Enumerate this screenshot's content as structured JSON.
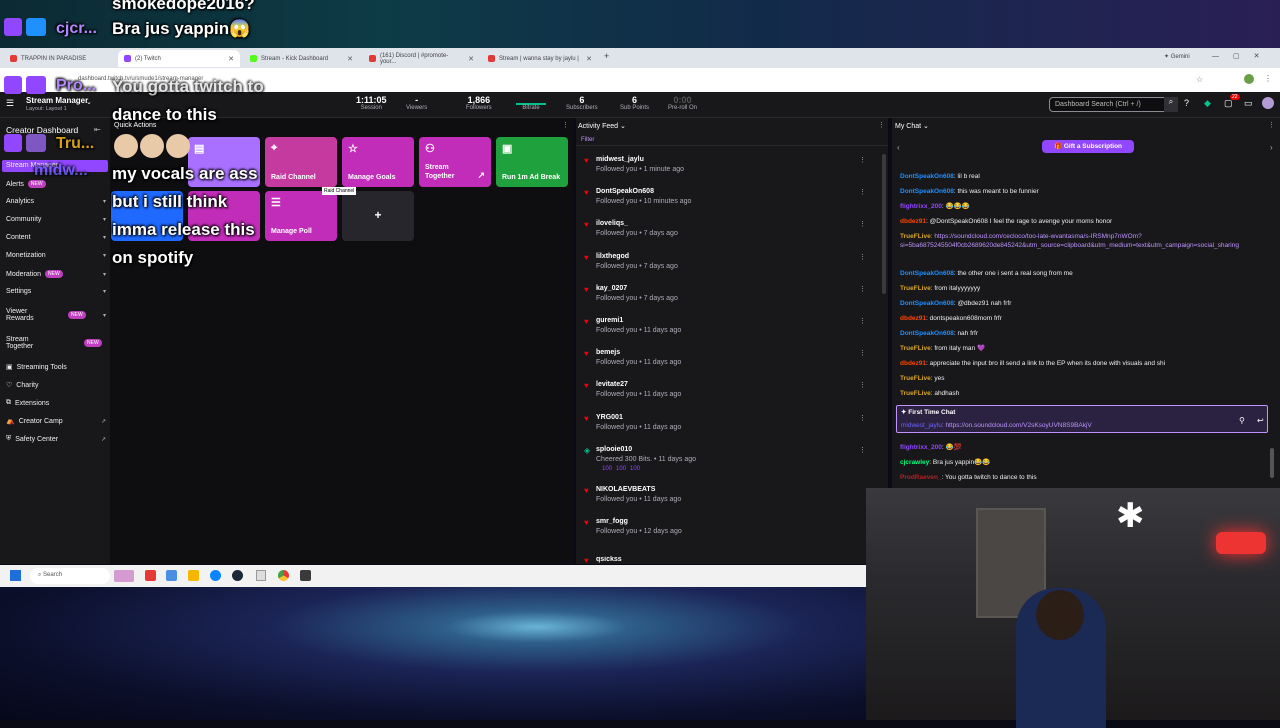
{
  "overlay": {
    "top_line": "smokedope2016?",
    "username": "cjcr...",
    "message1": "Bra jus yappin😱",
    "message2_line": "You gotta twitch to",
    "message2_line2": "dance to this",
    "user2": "Pro...",
    "user3": "Tru...",
    "user4": "midw...",
    "message3_line1": "my vocals are ass",
    "message3_line2": "but i still think",
    "message3_line3": "imma release this",
    "message3_line4": "on spotify"
  },
  "browser": {
    "tabs": [
      {
        "label": "TRAPPIN IN PARADISE",
        "color": "#e53935"
      },
      {
        "label": "(2) Twitch",
        "color": "#9146ff"
      },
      {
        "label": "Stream - Kick Dashboard",
        "color": "#53fc18"
      },
      {
        "label": "(161) Discord | #promote-your...",
        "color": "#e53935"
      },
      {
        "label": "Stream | wanna stay by jaylu |",
        "color": "#e53935"
      }
    ],
    "new_tab": "+",
    "gemini": "Gemini",
    "url": "dashboard.twitch.tv/u/smude1/stream-manager"
  },
  "header": {
    "title": "Stream Manager",
    "subtitle": "Layout: Layout 1",
    "stats": [
      {
        "value": "1:11:05",
        "label": "Session"
      },
      {
        "value": "-",
        "label": "Viewers"
      },
      {
        "value": "1,866",
        "label": "Followers"
      },
      {
        "value": "",
        "label": "Bitrate"
      },
      {
        "value": "6",
        "label": "Subscribers"
      },
      {
        "value": "6",
        "label": "Sub Points"
      },
      {
        "value": "0:00",
        "label": "Pre-roll On"
      }
    ],
    "search_placeholder": "Dashboard Search (Ctrl + /)",
    "notif_count": "22"
  },
  "sidebar": {
    "title": "Creator Dashboard",
    "items": [
      {
        "label": "Stream Manager"
      },
      {
        "label": "Alerts",
        "badge": "NEW"
      },
      {
        "label": "Analytics"
      },
      {
        "label": "Community"
      },
      {
        "label": "Content"
      },
      {
        "label": "Monetization"
      },
      {
        "label": "Moderation",
        "badge": "NEW"
      },
      {
        "label": "Settings"
      },
      {
        "label": "Viewer Rewards",
        "badge": "NEW"
      },
      {
        "label": "Stream Together",
        "badge": "NEW"
      },
      {
        "label": "Streaming Tools"
      },
      {
        "label": "Charity"
      },
      {
        "label": "Extensions"
      },
      {
        "label": "Creator Camp"
      },
      {
        "label": "Safety Center"
      }
    ]
  },
  "quick_actions": {
    "title": "Quick Actions",
    "tiles": [
      {
        "label": "",
        "color": "#a970ff"
      },
      {
        "label": "Raid Channel",
        "color": "#c53a9e"
      },
      {
        "label": "Manage Goals",
        "color": "#c12cb8"
      },
      {
        "label": "Stream Together",
        "color": "#c12cb8"
      },
      {
        "label": "Run 1m Ad Break",
        "color": "#1fa23d"
      },
      {
        "label": "Sub Only",
        "color": "#1f69ff"
      },
      {
        "label": "",
        "color": "#c12cb8"
      },
      {
        "label": "Manage Poll",
        "color": "#c12cb8"
      }
    ],
    "add": "+",
    "tooltip": "Raid Channel"
  },
  "activity": {
    "title": "Activity Feed",
    "filter": "Filter",
    "items": [
      {
        "name": "midwest_jaylu",
        "text": "Followed you • 1 minute ago"
      },
      {
        "name": "DontSpeakOn608",
        "text": "Followed you • 10 minutes ago"
      },
      {
        "name": "iloveliqs_",
        "text": "Followed you • 7 days ago"
      },
      {
        "name": "lilxthegod",
        "text": "Followed you • 7 days ago"
      },
      {
        "name": "kay_0207",
        "text": "Followed you • 7 days ago"
      },
      {
        "name": "guremi1",
        "text": "Followed you • 11 days ago"
      },
      {
        "name": "bemejs",
        "text": "Followed you • 11 days ago"
      },
      {
        "name": "levitate27",
        "text": "Followed you • 11 days ago"
      },
      {
        "name": "YRG001",
        "text": "Followed you • 11 days ago"
      },
      {
        "name": "splooie010",
        "text": "Cheered 300 Bits. • 11 days ago"
      },
      {
        "name": "NIKOLAEVBEATS",
        "text": "Followed you • 11 days ago"
      },
      {
        "name": "smr_fogg",
        "text": "Followed you • 12 days ago"
      },
      {
        "name": "qsickss",
        "text": ""
      }
    ],
    "bits": [
      "100",
      "100",
      "100"
    ]
  },
  "chat": {
    "title": "My Chat",
    "gift": "Gift a Subscription",
    "messages": [
      {
        "user": "DontSpeakOn608",
        "color": "#1e90ff",
        "text": ": lil b real"
      },
      {
        "user": "DontSpeakOn608",
        "color": "#1e90ff",
        "text": ": this was meant to be funnier"
      },
      {
        "user": "flightrixx_200",
        "color": "#9146ff",
        "text": ": 😂😂😂"
      },
      {
        "user": "dbdez91",
        "color": "#ff4500",
        "text": ": @DontSpeakOn608 I feel the rage to avenge your moms honor"
      },
      {
        "user": "TrueFLive",
        "color": "#daa520",
        "text": ": https://soundcloud.com/cecloco/too-late-wvantasma/s-IRSMnp7nWOm?si=5ba6875245504f0cb2689620de845242&utm_source=clipboard&utm_medium=text&utm_campaign=social_sharing"
      },
      {
        "user": "DontSpeakOn608",
        "color": "#1e90ff",
        "text": ": the other one i sent a real song from me"
      },
      {
        "user": "TrueFLive",
        "color": "#daa520",
        "text": ": from italyyyyyyy"
      },
      {
        "user": "DontSpeakOn608",
        "color": "#1e90ff",
        "text": ": @dbdez91 nah frfr"
      },
      {
        "user": "dbdez91",
        "color": "#ff4500",
        "text": ": dontspeakon608mom frfr"
      },
      {
        "user": "DontSpeakOn608",
        "color": "#1e90ff",
        "text": ": nah frfr"
      },
      {
        "user": "TrueFLive",
        "color": "#daa520",
        "text": ": from italy man 💜"
      },
      {
        "user": "dbdez91",
        "color": "#ff4500",
        "text": ": appreciate the input bro ill send a link to the EP when its done with visuals and shi"
      },
      {
        "user": "TrueFLive",
        "color": "#daa520",
        "text": ": yes"
      },
      {
        "user": "TrueFLive",
        "color": "#daa520",
        "text": ": ahdhash"
      }
    ],
    "first_time": {
      "title": "First Time Chat",
      "user": "midwest_jaylu",
      "text": ": https://on.soundcloud.com/V2sKsoyUVN8S9BAkjV"
    },
    "after": [
      {
        "user": "flightrixx_200",
        "color": "#9146ff",
        "text": ": 😂💯"
      },
      {
        "user": "cjcrawley",
        "color": "#00ff7f",
        "text": ": Bra jus yappin😂😂"
      },
      {
        "user": "ProdRaeven_",
        "color": "#b22222",
        "text": ": You gotta twitch to dance to this"
      }
    ]
  },
  "taskbar": {
    "search": "Search"
  }
}
